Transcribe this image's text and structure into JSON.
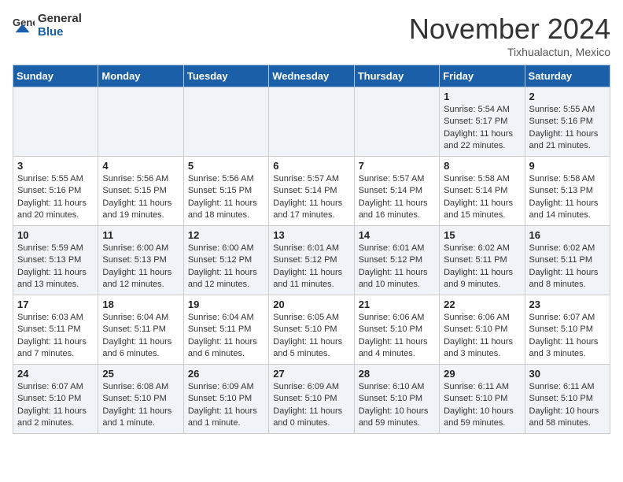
{
  "header": {
    "logo_general": "General",
    "logo_blue": "Blue",
    "month": "November 2024",
    "location": "Tixhualactun, Mexico"
  },
  "days_of_week": [
    "Sunday",
    "Monday",
    "Tuesday",
    "Wednesday",
    "Thursday",
    "Friday",
    "Saturday"
  ],
  "weeks": [
    [
      {
        "day": "",
        "info": ""
      },
      {
        "day": "",
        "info": ""
      },
      {
        "day": "",
        "info": ""
      },
      {
        "day": "",
        "info": ""
      },
      {
        "day": "",
        "info": ""
      },
      {
        "day": "1",
        "info": "Sunrise: 5:54 AM\nSunset: 5:17 PM\nDaylight: 11 hours and 22 minutes."
      },
      {
        "day": "2",
        "info": "Sunrise: 5:55 AM\nSunset: 5:16 PM\nDaylight: 11 hours and 21 minutes."
      }
    ],
    [
      {
        "day": "3",
        "info": "Sunrise: 5:55 AM\nSunset: 5:16 PM\nDaylight: 11 hours and 20 minutes."
      },
      {
        "day": "4",
        "info": "Sunrise: 5:56 AM\nSunset: 5:15 PM\nDaylight: 11 hours and 19 minutes."
      },
      {
        "day": "5",
        "info": "Sunrise: 5:56 AM\nSunset: 5:15 PM\nDaylight: 11 hours and 18 minutes."
      },
      {
        "day": "6",
        "info": "Sunrise: 5:57 AM\nSunset: 5:14 PM\nDaylight: 11 hours and 17 minutes."
      },
      {
        "day": "7",
        "info": "Sunrise: 5:57 AM\nSunset: 5:14 PM\nDaylight: 11 hours and 16 minutes."
      },
      {
        "day": "8",
        "info": "Sunrise: 5:58 AM\nSunset: 5:14 PM\nDaylight: 11 hours and 15 minutes."
      },
      {
        "day": "9",
        "info": "Sunrise: 5:58 AM\nSunset: 5:13 PM\nDaylight: 11 hours and 14 minutes."
      }
    ],
    [
      {
        "day": "10",
        "info": "Sunrise: 5:59 AM\nSunset: 5:13 PM\nDaylight: 11 hours and 13 minutes."
      },
      {
        "day": "11",
        "info": "Sunrise: 6:00 AM\nSunset: 5:13 PM\nDaylight: 11 hours and 12 minutes."
      },
      {
        "day": "12",
        "info": "Sunrise: 6:00 AM\nSunset: 5:12 PM\nDaylight: 11 hours and 12 minutes."
      },
      {
        "day": "13",
        "info": "Sunrise: 6:01 AM\nSunset: 5:12 PM\nDaylight: 11 hours and 11 minutes."
      },
      {
        "day": "14",
        "info": "Sunrise: 6:01 AM\nSunset: 5:12 PM\nDaylight: 11 hours and 10 minutes."
      },
      {
        "day": "15",
        "info": "Sunrise: 6:02 AM\nSunset: 5:11 PM\nDaylight: 11 hours and 9 minutes."
      },
      {
        "day": "16",
        "info": "Sunrise: 6:02 AM\nSunset: 5:11 PM\nDaylight: 11 hours and 8 minutes."
      }
    ],
    [
      {
        "day": "17",
        "info": "Sunrise: 6:03 AM\nSunset: 5:11 PM\nDaylight: 11 hours and 7 minutes."
      },
      {
        "day": "18",
        "info": "Sunrise: 6:04 AM\nSunset: 5:11 PM\nDaylight: 11 hours and 6 minutes."
      },
      {
        "day": "19",
        "info": "Sunrise: 6:04 AM\nSunset: 5:11 PM\nDaylight: 11 hours and 6 minutes."
      },
      {
        "day": "20",
        "info": "Sunrise: 6:05 AM\nSunset: 5:10 PM\nDaylight: 11 hours and 5 minutes."
      },
      {
        "day": "21",
        "info": "Sunrise: 6:06 AM\nSunset: 5:10 PM\nDaylight: 11 hours and 4 minutes."
      },
      {
        "day": "22",
        "info": "Sunrise: 6:06 AM\nSunset: 5:10 PM\nDaylight: 11 hours and 3 minutes."
      },
      {
        "day": "23",
        "info": "Sunrise: 6:07 AM\nSunset: 5:10 PM\nDaylight: 11 hours and 3 minutes."
      }
    ],
    [
      {
        "day": "24",
        "info": "Sunrise: 6:07 AM\nSunset: 5:10 PM\nDaylight: 11 hours and 2 minutes."
      },
      {
        "day": "25",
        "info": "Sunrise: 6:08 AM\nSunset: 5:10 PM\nDaylight: 11 hours and 1 minute."
      },
      {
        "day": "26",
        "info": "Sunrise: 6:09 AM\nSunset: 5:10 PM\nDaylight: 11 hours and 1 minute."
      },
      {
        "day": "27",
        "info": "Sunrise: 6:09 AM\nSunset: 5:10 PM\nDaylight: 11 hours and 0 minutes."
      },
      {
        "day": "28",
        "info": "Sunrise: 6:10 AM\nSunset: 5:10 PM\nDaylight: 10 hours and 59 minutes."
      },
      {
        "day": "29",
        "info": "Sunrise: 6:11 AM\nSunset: 5:10 PM\nDaylight: 10 hours and 59 minutes."
      },
      {
        "day": "30",
        "info": "Sunrise: 6:11 AM\nSunset: 5:10 PM\nDaylight: 10 hours and 58 minutes."
      }
    ]
  ]
}
